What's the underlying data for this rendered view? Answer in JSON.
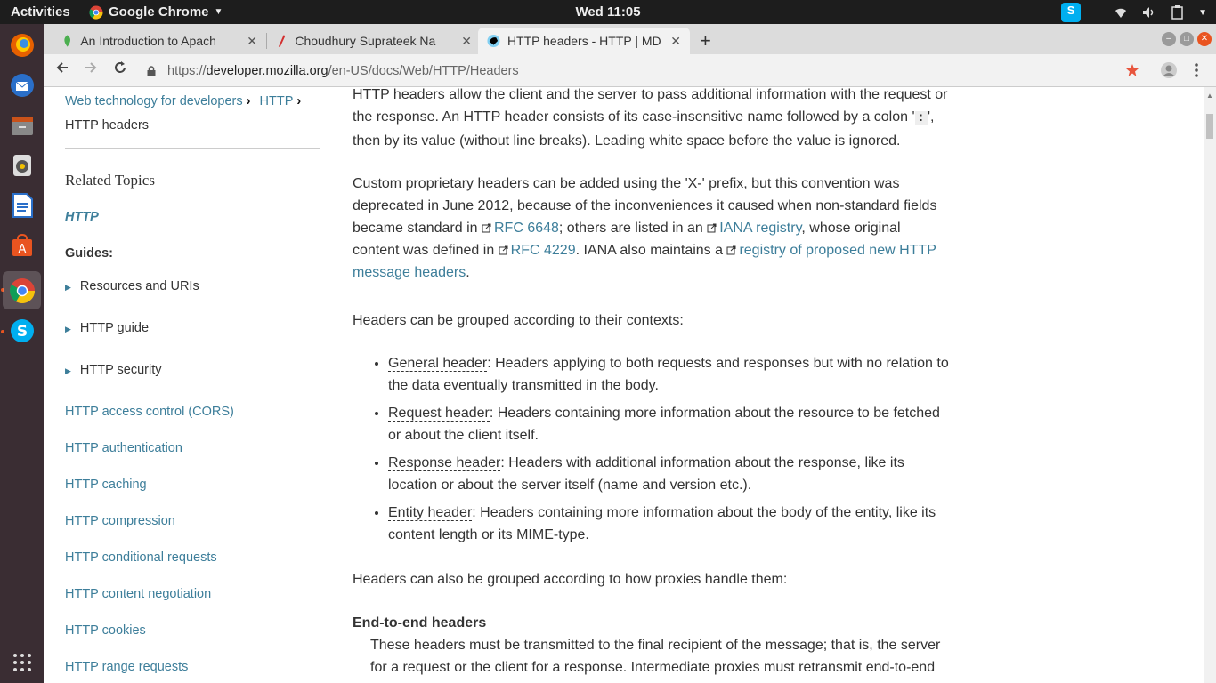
{
  "topbar": {
    "activities": "Activities",
    "app_name": "Google Chrome",
    "clock": "Wed 11:05"
  },
  "tabs": [
    {
      "title": "An Introduction to Apach",
      "close": "✕"
    },
    {
      "title": "Choudhury Suprateek Na",
      "close": "✕"
    },
    {
      "title": "HTTP headers - HTTP | MD",
      "close": "✕"
    }
  ],
  "newtab": "+",
  "url": {
    "scheme": "https://",
    "host": "developer.mozilla.org",
    "path": "/en-US/docs/Web/HTTP/Headers"
  },
  "sidebar": {
    "crumb1": "Web technology for developers",
    "crumb2": "HTTP",
    "crumb_current": "HTTP headers",
    "related_topics": "Related Topics",
    "http": "HTTP",
    "guides": "Guides:",
    "guide_items": [
      "Resources and URIs",
      "HTTP guide",
      "HTTP security"
    ],
    "links": [
      "HTTP access control (CORS)",
      "HTTP authentication",
      "HTTP caching",
      "HTTP compression",
      "HTTP conditional requests",
      "HTTP content negotiation",
      "HTTP cookies",
      "HTTP range requests"
    ]
  },
  "article": {
    "p1_a": "HTTP headers allow the client and the server to pass additional information with the request or the response. An HTTP header consists of its case-insensitive name followed by a colon '",
    "p1_code": ":",
    "p1_b": "', then by its value (without line breaks). Leading white space before the value is ignored.",
    "p2_a": "Custom proprietary headers can be added using the 'X-' prefix, but this convention was deprecated in June 2012, because of the inconveniences it caused when non-standard fields became standard in ",
    "p2_link1": "RFC 6648",
    "p2_b": "; others are listed in an ",
    "p2_link2": "IANA registry",
    "p2_c": ", whose original content was defined in ",
    "p2_link3": "RFC 4229",
    "p2_d": ". IANA also maintains a ",
    "p2_link4": "registry of proposed new HTTP message headers",
    "p2_e": ".",
    "p3": "Headers can be grouped according to their contexts:",
    "contexts": [
      {
        "term": "General header",
        "desc": ": Headers applying to both requests and responses but with no relation to the data eventually transmitted in the body."
      },
      {
        "term": "Request header",
        "desc": ": Headers containing more information about the resource to be fetched or about the client itself."
      },
      {
        "term": "Response header",
        "desc": ": Headers with additional information about the response, like its location or about the server itself (name and version etc.)."
      },
      {
        "term": "Entity header",
        "desc": ": Headers containing more information about the body of the entity, like its content length or its MIME-type."
      }
    ],
    "p4": "Headers can also be grouped according to how proxies handle them:",
    "h_e2e": "End-to-end headers",
    "e2e_desc": "These headers must be transmitted to the final recipient of the message; that is, the server for a request or the client for a response. Intermediate proxies must retransmit end-to-end"
  },
  "colors": {
    "link": "#3d7e9a",
    "dock": "#3a2d33",
    "accent": "#e95420"
  }
}
